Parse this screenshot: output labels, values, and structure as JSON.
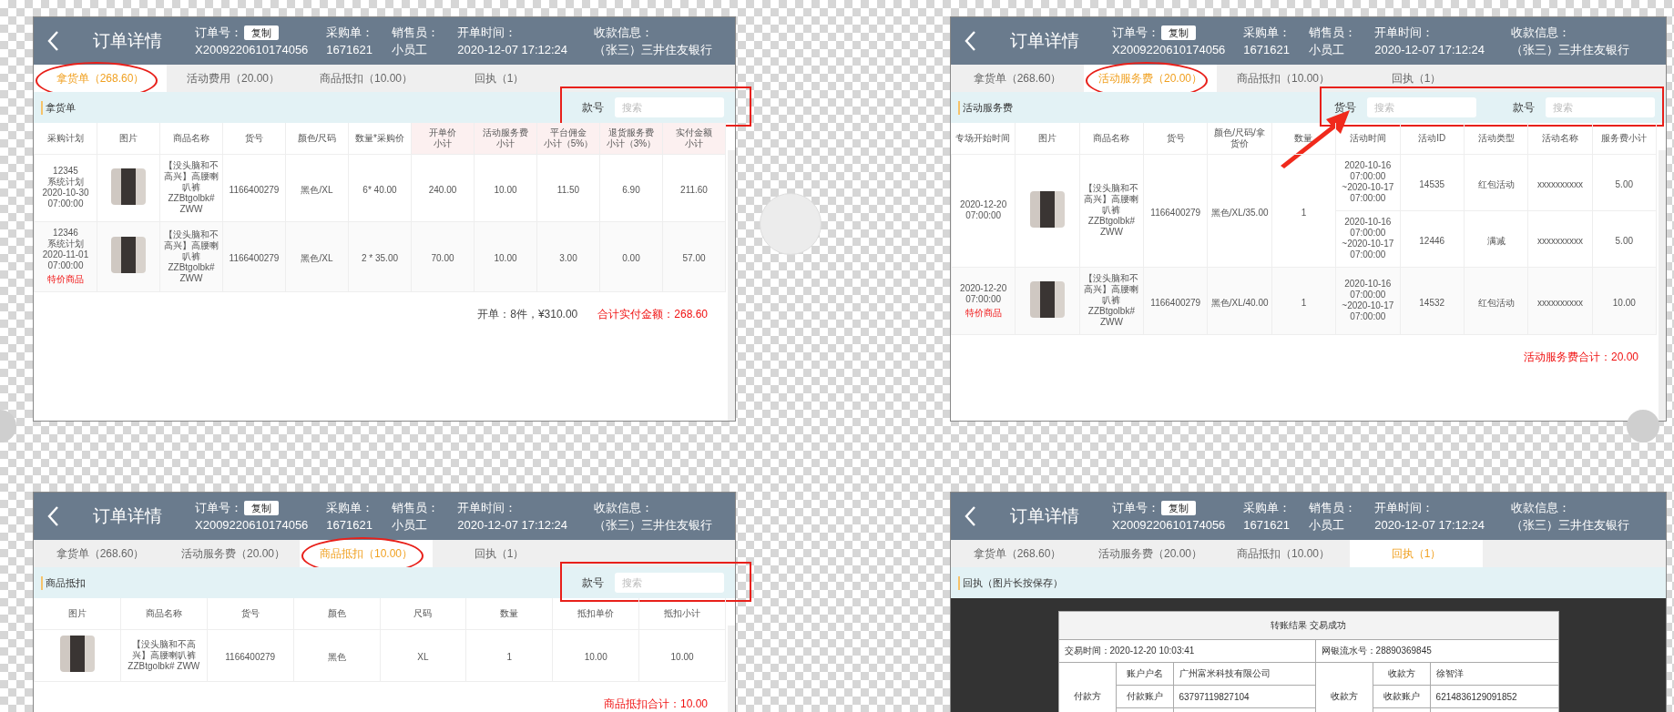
{
  "panels": [
    {
      "kind": "table",
      "header": {
        "title": "订单详情",
        "order_label": "订单号：",
        "copy_button": "复制",
        "order_no": "X2009220610174056",
        "fields": [
          {
            "label": "采购单：",
            "value": "1671621"
          },
          {
            "label": "销售员：",
            "value": "小员工"
          },
          {
            "label": "开单时间：",
            "value": "2020-12-07 17:12:24"
          },
          {
            "label": "收款信息：",
            "value": "（张三）三井住友银行"
          }
        ]
      },
      "tabs": [
        {
          "label": "拿货单（268.60）",
          "selected": true
        },
        {
          "label": "活动费用（20.00）",
          "selected": false
        },
        {
          "label": "商品抵扣（10.00）",
          "selected": false
        },
        {
          "label": "回执（1）",
          "selected": false
        }
      ],
      "section_title": "拿货单",
      "searches": [
        {
          "label": "款号",
          "placeholder": "搜索"
        }
      ],
      "annotations": {
        "tab_circle": true,
        "search_box": true,
        "arrow": false
      },
      "columns": [
        {
          "label": "采购计划",
          "kind": "text",
          "highlight": false
        },
        {
          "label": "图片",
          "kind": "image",
          "highlight": false
        },
        {
          "label": "商品名称",
          "kind": "text",
          "highlight": false
        },
        {
          "label": "货号",
          "kind": "text",
          "highlight": false
        },
        {
          "label": "颜色/尺码",
          "kind": "text",
          "highlight": false
        },
        {
          "label": "数量*采购价",
          "kind": "text",
          "highlight": false
        },
        {
          "label": "开单价",
          "sublabel": "小计",
          "kind": "text",
          "highlight": true
        },
        {
          "label": "活动服务费",
          "sublabel": "小计",
          "kind": "text",
          "highlight": true
        },
        {
          "label": "平台佣金",
          "sublabel": "小计（5%）",
          "kind": "text",
          "highlight": true
        },
        {
          "label": "退货服务费",
          "sublabel": "小计（3%）",
          "kind": "text",
          "highlight": true
        },
        {
          "label": "实付金额",
          "sublabel": "小计",
          "kind": "text",
          "highlight": true
        }
      ],
      "rows": [
        {
          "cells": [
            "12345\n系统计划\n2020-10-30\n07:00:00",
            "",
            "【没头脑和不高兴】高腰喇叭裤ZZBtgolbk# ZWW",
            "1166400279",
            "黑色/XL",
            "6* 40.00",
            "240.00",
            "10.00",
            "11.50",
            "6.90",
            "211.60"
          ]
        },
        {
          "cells": [
            "12346\n系统计划\n2020-11-01\n07:00:00",
            "",
            "【没头脑和不高兴】高腰喇叭裤ZZBtgolbk# ZWW",
            "1166400279",
            "黑色/XL",
            "2 * 35.00",
            "70.00",
            "10.00",
            "3.00",
            "0.00",
            "57.00"
          ],
          "tag": "特价商品"
        }
      ],
      "totals": [
        {
          "text": "开单：8件，¥310.00",
          "kind": "plain"
        },
        {
          "text": "合计实付金额：268.60",
          "kind": "emphasis"
        }
      ]
    },
    {
      "kind": "table",
      "header": {
        "title": "订单详情",
        "order_label": "订单号：",
        "copy_button": "复制",
        "order_no": "X2009220610174056",
        "fields": [
          {
            "label": "采购单：",
            "value": "1671621"
          },
          {
            "label": "销售员：",
            "value": "小员工"
          },
          {
            "label": "开单时间：",
            "value": "2020-12-07 17:12:24"
          },
          {
            "label": "收款信息：",
            "value": "（张三）三井住友银行"
          }
        ]
      },
      "tabs": [
        {
          "label": "拿货单（268.60）",
          "selected": false
        },
        {
          "label": "活动服务费（20.00）",
          "selected": true
        },
        {
          "label": "商品抵扣（10.00）",
          "selected": false
        },
        {
          "label": "回执（1）",
          "selected": false
        }
      ],
      "section_title": "活动服务费",
      "searches": [
        {
          "label": "货号",
          "placeholder": "搜索"
        },
        {
          "label": "款号",
          "placeholder": "搜索"
        }
      ],
      "annotations": {
        "tab_circle": true,
        "search_box": true,
        "arrow": true
      },
      "columns": [
        {
          "label": "专场开始时间",
          "kind": "text"
        },
        {
          "label": "图片",
          "kind": "image"
        },
        {
          "label": "商品名称",
          "kind": "text"
        },
        {
          "label": "货号",
          "kind": "text"
        },
        {
          "label": "颜色/尺码/拿货价",
          "kind": "text"
        },
        {
          "label": "数量",
          "kind": "text"
        },
        {
          "label": "活动时间",
          "kind": "activity"
        },
        {
          "label": "活动ID",
          "kind": "activity"
        },
        {
          "label": "活动类型",
          "kind": "activity"
        },
        {
          "label": "活动名称",
          "kind": "activity"
        },
        {
          "label": "服务费小计",
          "kind": "activity"
        }
      ],
      "rows": [
        {
          "cells": [
            "2020-12-20\n07:00:00",
            "",
            "【没头脑和不高兴】高腰喇叭裤ZZBtgolbk# ZWW",
            "1166400279",
            "黑色/XL/35.00",
            "1"
          ],
          "activities": [
            [
              "2020-10-16\n07:00:00\n~2020-10-17\n07:00:00",
              "14535",
              "红包活动",
              "xxxxxxxxxx",
              "5.00"
            ],
            [
              "2020-10-16\n07:00:00\n~2020-10-17\n07:00:00",
              "12446",
              "满减",
              "xxxxxxxxxx",
              "5.00"
            ]
          ]
        },
        {
          "cells": [
            "2020-12-20\n07:00:00",
            "",
            "【没头脑和不高兴】高腰喇叭裤ZZBtgolbk# ZWW",
            "1166400279",
            "黑色/XL/40.00",
            "1"
          ],
          "tag": "特价商品",
          "activities": [
            [
              "2020-10-16\n07:00:00\n~2020-10-17\n07:00:00",
              "14532",
              "红包活动",
              "xxxxxxxxxx",
              "10.00"
            ]
          ]
        }
      ],
      "totals": [
        {
          "text": "活动服务费合计：20.00",
          "kind": "emphasis"
        }
      ]
    },
    {
      "kind": "table",
      "header": {
        "title": "订单详情",
        "order_label": "订单号：",
        "copy_button": "复制",
        "order_no": "X2009220610174056",
        "fields": [
          {
            "label": "采购单：",
            "value": "1671621"
          },
          {
            "label": "销售员：",
            "value": "小员工"
          },
          {
            "label": "开单时间：",
            "value": "2020-12-07 17:12:24"
          },
          {
            "label": "收款信息：",
            "value": "（张三）三井住友银行"
          }
        ]
      },
      "tabs": [
        {
          "label": "拿货单（268.60）",
          "selected": false
        },
        {
          "label": "活动服务费（20.00）",
          "selected": false
        },
        {
          "label": "商品抵扣（10.00）",
          "selected": true
        },
        {
          "label": "回执（1）",
          "selected": false
        }
      ],
      "section_title": "商品抵扣",
      "searches": [
        {
          "label": "款号",
          "placeholder": "搜索"
        }
      ],
      "annotations": {
        "tab_circle": true,
        "search_box": true,
        "arrow": false
      },
      "columns": [
        {
          "label": "图片",
          "kind": "image"
        },
        {
          "label": "商品名称",
          "kind": "text"
        },
        {
          "label": "货号",
          "kind": "text"
        },
        {
          "label": "颜色",
          "kind": "text"
        },
        {
          "label": "尺码",
          "kind": "text"
        },
        {
          "label": "数量",
          "kind": "text"
        },
        {
          "label": "抵扣单价",
          "kind": "text"
        },
        {
          "label": "抵扣小计",
          "kind": "text"
        }
      ],
      "rows": [
        {
          "cells": [
            "",
            "【没头脑和不高兴】高腰喇叭裤 ZZBtgolbk# ZWW",
            "1166400279",
            "黑色",
            "XL",
            "1",
            "10.00",
            "10.00"
          ]
        }
      ],
      "totals": [
        {
          "text": "商品抵扣合计：10.00",
          "kind": "emphasis"
        }
      ]
    },
    {
      "kind": "receipt",
      "header": {
        "title": "订单详情",
        "order_label": "订单号：",
        "copy_button": "复制",
        "order_no": "X2009220610174056",
        "fields": [
          {
            "label": "采购单：",
            "value": "1671621"
          },
          {
            "label": "销售员：",
            "value": "小员工"
          },
          {
            "label": "开单时间：",
            "value": "2020-12-07 17:12:24"
          },
          {
            "label": "收款信息：",
            "value": "（张三）三井住友银行"
          }
        ]
      },
      "tabs": [
        {
          "label": "拿货单（268.60）",
          "selected": false
        },
        {
          "label": "活动服务费（20.00）",
          "selected": false
        },
        {
          "label": "商品抵扣（10.00）",
          "selected": false
        },
        {
          "label": "回执（1）",
          "selected": true
        }
      ],
      "section_title": "回执（图片长按保存）",
      "annotations": {
        "tab_circle": false,
        "search_box": false,
        "arrow": false
      },
      "receipt": {
        "title": "转账结果 交易成功",
        "time": "交易时间：2020-12-20 10:03:41",
        "serial": "网银流水号：28890369845",
        "parties": [
          {
            "role": "付款方",
            "fields": [
              {
                "label": "账户户名",
                "value": "广州富米科技有限公司"
              },
              {
                "label": "付款账户",
                "value": "63797119827104"
              }
            ]
          },
          {
            "role": "收款方",
            "fields": [
              {
                "label": "收款方",
                "value": "徐智洋"
              },
              {
                "label": "收款账户",
                "value": "6214836129091852"
              }
            ]
          }
        ]
      }
    }
  ]
}
